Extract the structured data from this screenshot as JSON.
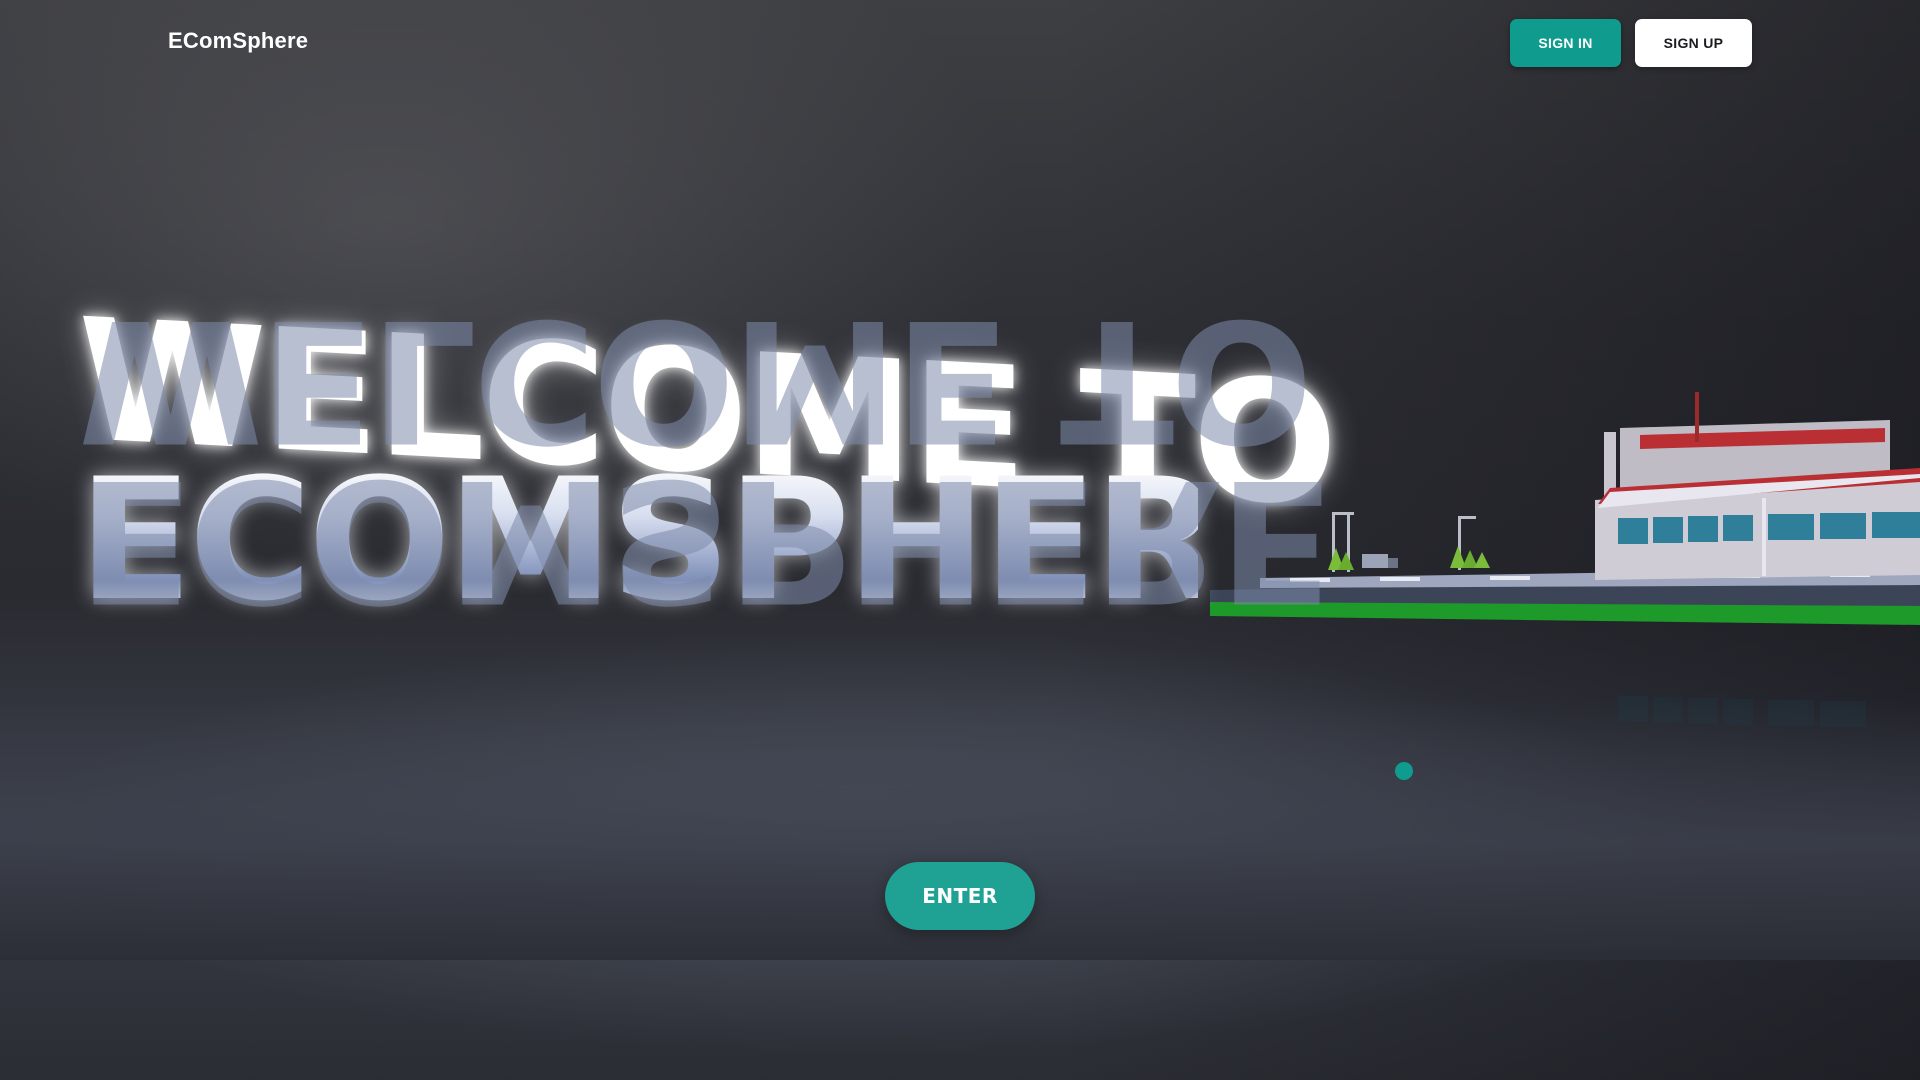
{
  "header": {
    "logo_text": "EComSphere",
    "sign_in_label": "SIGN IN",
    "sign_up_label": "SIGN UP"
  },
  "hero": {
    "line1": "WELCOME TO",
    "line2": "ECOMSPHERE"
  },
  "enter_label": "ENTER",
  "colors": {
    "accent": "#0f9b8e",
    "enter_button": "#1fa294",
    "background": "#2f3036",
    "building_roof_stripe": "#9b2b2b",
    "grass": "#1d9a2a"
  }
}
